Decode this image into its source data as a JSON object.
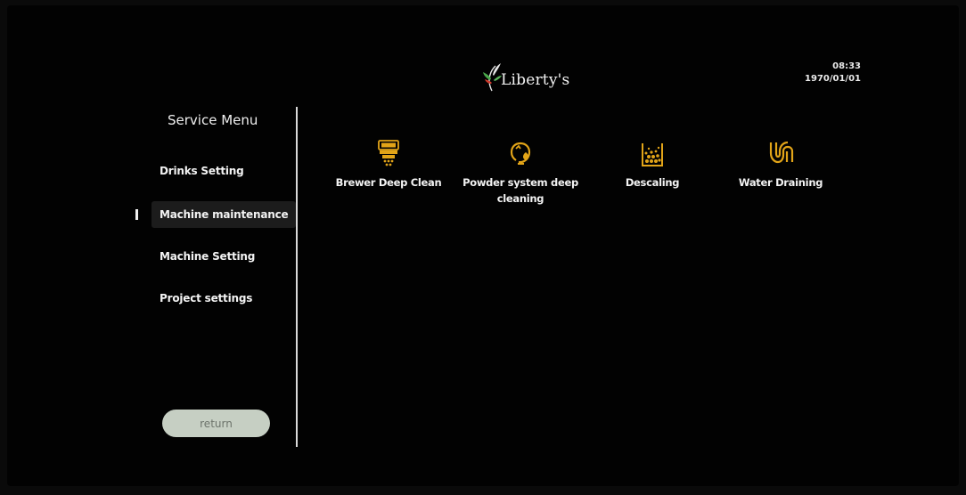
{
  "header": {
    "brand": "Liberty's",
    "time": "08:33",
    "date": "1970/01/01"
  },
  "sidebar": {
    "title": "Service Menu",
    "items": [
      {
        "label": "Drinks Setting",
        "active": false
      },
      {
        "label": "Machine maintenance",
        "active": true
      },
      {
        "label": "Machine Setting",
        "active": false
      },
      {
        "label": "Project settings",
        "active": false
      }
    ],
    "return_label": "return"
  },
  "main": {
    "tiles": [
      {
        "label": "Brewer Deep Clean",
        "icon": "coffee-brewer-icon"
      },
      {
        "label": "Powder system deep cleaning",
        "icon": "powder-cleaning-icon"
      },
      {
        "label": "Descaling",
        "icon": "descaling-icon"
      },
      {
        "label": "Water Draining",
        "icon": "water-drain-icon"
      }
    ]
  },
  "colors": {
    "background": "#020202",
    "accent_gold": "#e2a418",
    "return_button": "#c6cfc3"
  }
}
